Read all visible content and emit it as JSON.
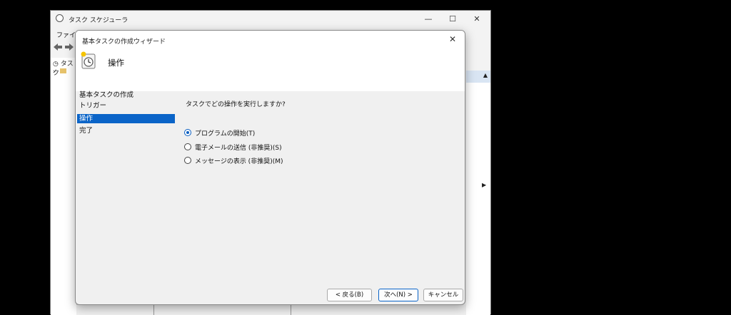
{
  "main_window": {
    "title": "タスク スケジューラ",
    "menu": [
      "ファイル"
    ],
    "tree": [
      "タスク"
    ],
    "controls": {
      "minimize": "—",
      "maximize": "☐",
      "close": "✕"
    }
  },
  "dialog": {
    "title": "基本タスクの作成ウィザード",
    "close": "✕",
    "header_title": "操作",
    "steps": [
      {
        "label": "基本タスクの作成",
        "active": false
      },
      {
        "label": "トリガー",
        "active": false
      },
      {
        "label": "操作",
        "active": true
      },
      {
        "label": "完了",
        "active": false
      }
    ],
    "question": "タスクでどの操作を実行しますか?",
    "options": [
      {
        "label": "プログラムの開始(T)",
        "checked": true
      },
      {
        "label": "電子メールの送信 (非推奨)(S)",
        "checked": false
      },
      {
        "label": "メッセージの表示 (非推奨)(M)",
        "checked": false
      }
    ],
    "buttons": {
      "back": "< 戻る(B)",
      "next": "次へ(N) >",
      "cancel": "キャンセル"
    }
  },
  "colors": {
    "accent": "#0a64c8",
    "selected_step_bg": "#0a64c8"
  }
}
